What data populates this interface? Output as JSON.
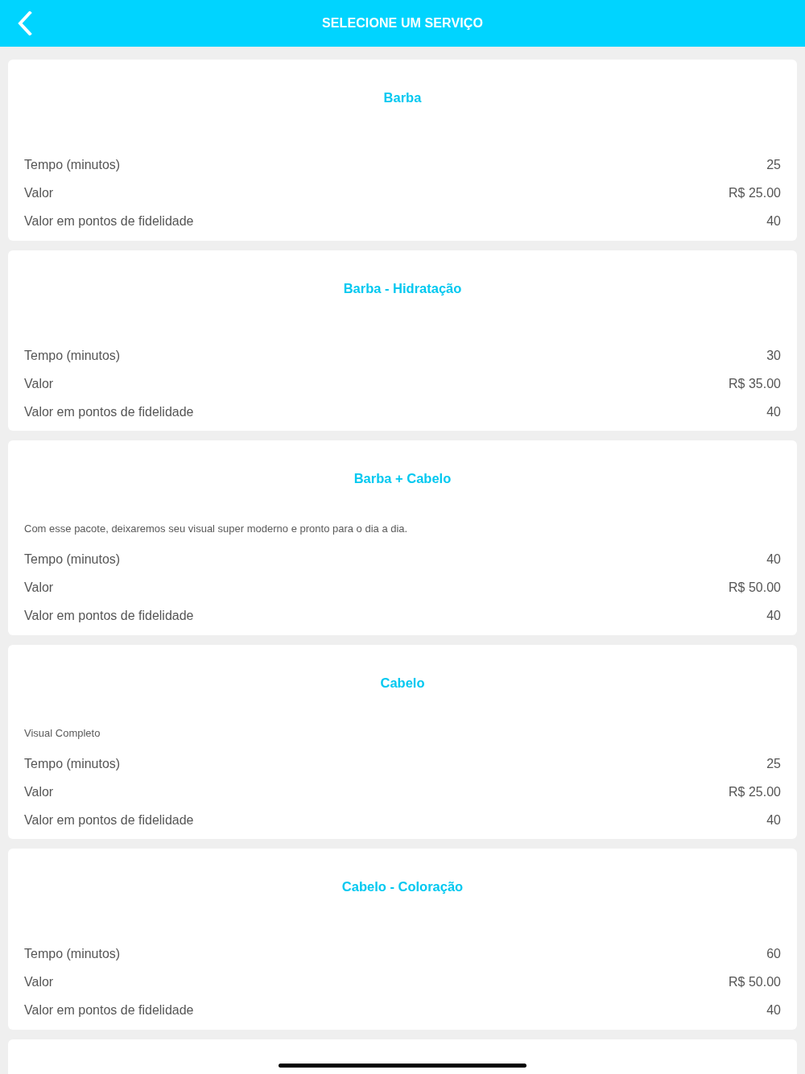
{
  "header": {
    "title": "SELECIONE UM SERVIÇO"
  },
  "services": [
    {
      "name": "Barba",
      "details": [
        {
          "label": "Tempo (minutos)",
          "value": "25"
        },
        {
          "label": "Valor",
          "value": "R$ 25.00"
        },
        {
          "label": "Valor em pontos de fidelidade",
          "value": "40"
        }
      ]
    },
    {
      "name": "Barba - Hidratação",
      "details": [
        {
          "label": "Tempo (minutos)",
          "value": "30"
        },
        {
          "label": "Valor",
          "value": "R$ 35.00"
        },
        {
          "label": "Valor em pontos de fidelidade",
          "value": "40"
        }
      ]
    },
    {
      "name": "Barba + Cabelo",
      "description": "Com esse pacote, deixaremos seu visual super moderno e pronto para o dia a dia.",
      "details": [
        {
          "label": "Tempo (minutos)",
          "value": "40"
        },
        {
          "label": "Valor",
          "value": "R$ 50.00"
        },
        {
          "label": "Valor em pontos de fidelidade",
          "value": "40"
        }
      ]
    },
    {
      "name": "Cabelo",
      "description": "Visual Completo",
      "details": [
        {
          "label": "Tempo (minutos)",
          "value": "25"
        },
        {
          "label": "Valor",
          "value": "R$ 25.00"
        },
        {
          "label": "Valor em pontos de fidelidade",
          "value": "40"
        }
      ]
    },
    {
      "name": "Cabelo - Coloração",
      "details": [
        {
          "label": "Tempo (minutos)",
          "value": "60"
        },
        {
          "label": "Valor",
          "value": "R$ 50.00"
        },
        {
          "label": "Valor em pontos de fidelidade",
          "value": "40"
        }
      ]
    }
  ],
  "list_continues": true
}
